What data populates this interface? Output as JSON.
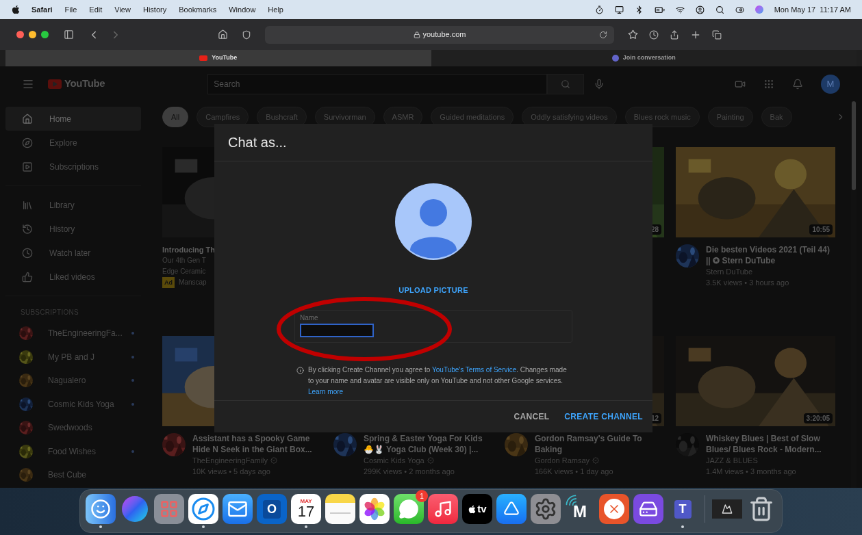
{
  "menu_bar": {
    "app": "Safari",
    "menus": [
      "File",
      "Edit",
      "View",
      "History",
      "Bookmarks",
      "Window",
      "Help"
    ],
    "clock": "Mon May 17  11:17 AM"
  },
  "browser": {
    "address": "youtube.com",
    "tabs": [
      {
        "title": "YouTube",
        "selected": true
      },
      {
        "title": "Join conversation",
        "selected": false
      }
    ]
  },
  "youtube": {
    "logo": "YouTube",
    "search_placeholder": "Search",
    "account_initial": "M",
    "nav": [
      {
        "label": "Home",
        "selected": true
      },
      {
        "label": "Explore",
        "selected": false
      },
      {
        "label": "Subscriptions",
        "selected": false
      }
    ],
    "library": [
      {
        "label": "Library",
        "selected": false
      },
      {
        "label": "History",
        "selected": false
      },
      {
        "label": "Watch later",
        "selected": false
      },
      {
        "label": "Liked videos",
        "selected": false
      }
    ],
    "subscriptions_heading": "SUBSCRIPTIONS",
    "subscriptions": [
      {
        "name": "TheEngineeringFa...",
        "new_content": true
      },
      {
        "name": "My PB and J",
        "new_content": true
      },
      {
        "name": "Nagualero",
        "new_content": true
      },
      {
        "name": "Cosmic Kids Yoga",
        "new_content": true
      },
      {
        "name": "Swedwoods",
        "new_content": false
      },
      {
        "name": "Food Wishes",
        "new_content": true
      },
      {
        "name": "Best Cube",
        "new_content": false
      }
    ],
    "chips": [
      {
        "label": "All",
        "selected": true
      },
      {
        "label": "Campfires",
        "selected": false
      },
      {
        "label": "Bushcraft",
        "selected": false
      },
      {
        "label": "Survivorman",
        "selected": false
      },
      {
        "label": "ASMR",
        "selected": false
      },
      {
        "label": "Guided meditations",
        "selected": false
      },
      {
        "label": "Oddly satisfying videos",
        "selected": false
      },
      {
        "label": "Blues rock music",
        "selected": false
      },
      {
        "label": "Painting",
        "selected": false
      },
      {
        "label": "Bak",
        "selected": false
      }
    ],
    "videos_row_1": [
      {
        "kind": "ad",
        "title": "Introducing Th",
        "lines": [
          "Our 4th Gen T",
          "Edge Ceramic"
        ],
        "badge": "Ad",
        "advertiser": "Manscap"
      },
      {
        "kind": "covered",
        "duration": "28"
      },
      {
        "kind": "video",
        "duration": "10:55",
        "title": "Die besten Videos 2021 (Teil 44) || ✪ Stern DuTube",
        "channel": "Stern DuTube",
        "verified": false,
        "stats": "3.5K views • 3 hours ago"
      }
    ],
    "videos_row_2": [
      {
        "title": "Assistant has a Spooky Game Hide N Seek in the Giant Box...",
        "channel": "TheEngineeringFamily",
        "verified": true,
        "stats": "10K views • 5 days ago"
      },
      {
        "title": "Spring & Easter Yoga For Kids 🐣🐰 Yoga Club (Week 30) |...",
        "channel": "Cosmic Kids Yoga",
        "verified": true,
        "stats": "299K views • 2 months ago"
      },
      {
        "duration": "12",
        "title": "Gordon Ramsay's Guide To Baking",
        "channel": "Gordon Ramsay",
        "verified": true,
        "stats": "166K views • 1 day ago"
      },
      {
        "duration": "3:20:05",
        "title": "Whiskey Blues | Best of Slow Blues/ Blues Rock - Modern...",
        "channel": "JAZZ & BLUES",
        "verified": false,
        "stats": "1.4M views • 3 months ago"
      }
    ]
  },
  "dialog": {
    "title": "Chat as...",
    "upload": "UPLOAD PICTURE",
    "field_label": "Name",
    "field_focused": true,
    "value_redacted": true,
    "notice_before": "By clicking Create Channel you agree to ",
    "notice_link": "YouTube's Terms of Service",
    "notice_after": ". Changes made to your name and avatar are visible only on YouTube and not other Google services. ",
    "learn_more": "Learn more",
    "buttons": [
      {
        "label": "CANCEL",
        "kind": "secondary"
      },
      {
        "label": "CREATE CHANNEL",
        "kind": "primary"
      }
    ]
  },
  "dock": [
    {
      "kind": "finder",
      "running": true
    },
    {
      "kind": "siri",
      "running": false
    },
    {
      "kind": "launchpad",
      "running": false
    },
    {
      "kind": "safari",
      "running": true
    },
    {
      "kind": "mail",
      "running": false
    },
    {
      "kind": "outlook",
      "label": "O",
      "running": false
    },
    {
      "kind": "calendar",
      "month": "MAY",
      "day": "17",
      "running": true
    },
    {
      "kind": "notes",
      "running": false
    },
    {
      "kind": "photos",
      "running": false
    },
    {
      "kind": "messages",
      "badge": "1",
      "running": false
    },
    {
      "kind": "music",
      "running": false
    },
    {
      "kind": "tv",
      "label": "tv",
      "running": false
    },
    {
      "kind": "appstore",
      "running": false
    },
    {
      "kind": "settings",
      "running": false
    },
    {
      "kind": "m_app",
      "label": "M",
      "running": false
    },
    {
      "kind": "remote",
      "running": false
    },
    {
      "kind": "drive",
      "running": false
    },
    {
      "kind": "teams",
      "label": "T",
      "running": true
    },
    {
      "kind": "separator"
    },
    {
      "kind": "window_preview",
      "running": false
    },
    {
      "kind": "trash",
      "running": false
    }
  ]
}
